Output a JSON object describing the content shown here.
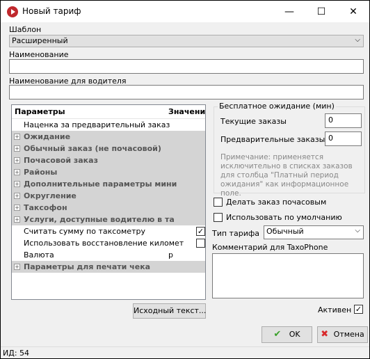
{
  "window": {
    "title": "Новый тариф",
    "minimize": "—",
    "maximize": "☐",
    "close": "✕"
  },
  "template": {
    "label": "Шаблон",
    "value": "Расширенный"
  },
  "name": {
    "label": "Наименование",
    "value": ""
  },
  "driver_name": {
    "label": "Наименование для водителя",
    "value": ""
  },
  "params": {
    "col_params": "Параметры",
    "col_values": "Значения",
    "rows": [
      {
        "label": "Наценка за предварительный заказ"
      },
      {
        "label": "Ожидание"
      },
      {
        "label": "Обычный заказ (не почасовой)"
      },
      {
        "label": "Почасовой заказ"
      },
      {
        "label": "Районы"
      },
      {
        "label": "Дополнительные параметры мини"
      },
      {
        "label": "Округление"
      },
      {
        "label": "Таксофон"
      },
      {
        "label": "Услуги, доступные водителю в та"
      },
      {
        "label": "Считать сумму по таксометру",
        "checked": true
      },
      {
        "label": "Использовать восстановление километ",
        "checked": false
      },
      {
        "label": "Валюта",
        "value": "р"
      },
      {
        "label": "Параметры для печати чека"
      }
    ],
    "expand_glyph": "+",
    "check_glyph": "✓"
  },
  "free_wait": {
    "title": "Бесплатное ожидание (мин)",
    "current_label": "Текущие заказы",
    "current_value": "0",
    "pre_label": "Предварительные заказы",
    "pre_value": "0",
    "note": "Примечание: применяется исключительно в списках заказов для столбца \"Платный период ожидания\" как информационное поле."
  },
  "hourly_checkbox": {
    "label": "Делать заказ почасовым"
  },
  "default_checkbox": {
    "label": "Использовать по умолчанию"
  },
  "tariff_type": {
    "label": "Тип тарифа",
    "value": "Обычный"
  },
  "comment": {
    "label": "Комментарий для TaxoPhone",
    "value": ""
  },
  "source_button": "Исходный текст...",
  "active": {
    "label": "Активен",
    "checked": true
  },
  "ok_button": "OK",
  "cancel_button": "Отмена",
  "status": "ИД: 54"
}
